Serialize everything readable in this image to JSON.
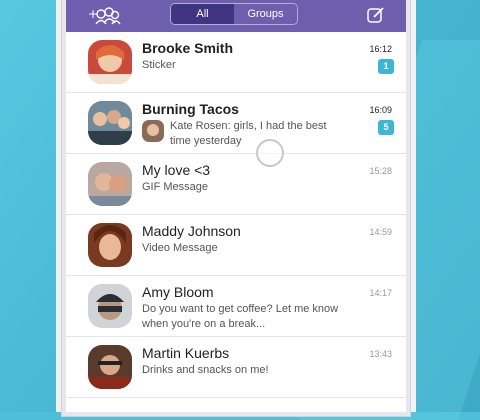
{
  "header": {
    "tabs": [
      {
        "label": "All",
        "active": true
      },
      {
        "label": "Groups",
        "active": false
      }
    ],
    "add_group_icon": "add-group-icon",
    "compose_icon": "compose-icon",
    "accent": "#6e5fae"
  },
  "chats": [
    {
      "name": "Brooke Smith",
      "preview": "Sticker",
      "time": "16:12",
      "unread": "1",
      "bold": true
    },
    {
      "name": "Burning Tacos",
      "sender": "Kate Rosen:",
      "preview": "girls, I had the best time yesterday",
      "time": "16:09",
      "unread": "5",
      "bold": true
    },
    {
      "name": "My love <3",
      "preview": "GIF Message",
      "time": "15:28",
      "bold": false
    },
    {
      "name": "Maddy Johnson",
      "preview": "Video Message",
      "time": "14:59",
      "bold": false
    },
    {
      "name": "Amy Bloom",
      "preview": "Do you want to get coffee? Let me know when you're on a break...",
      "time": "14:17",
      "bold": false
    },
    {
      "name": "Martin Kuerbs",
      "preview": "Drinks and snacks on me!",
      "time": "13:43",
      "bold": false
    }
  ],
  "badge_color": "#3db6d2"
}
